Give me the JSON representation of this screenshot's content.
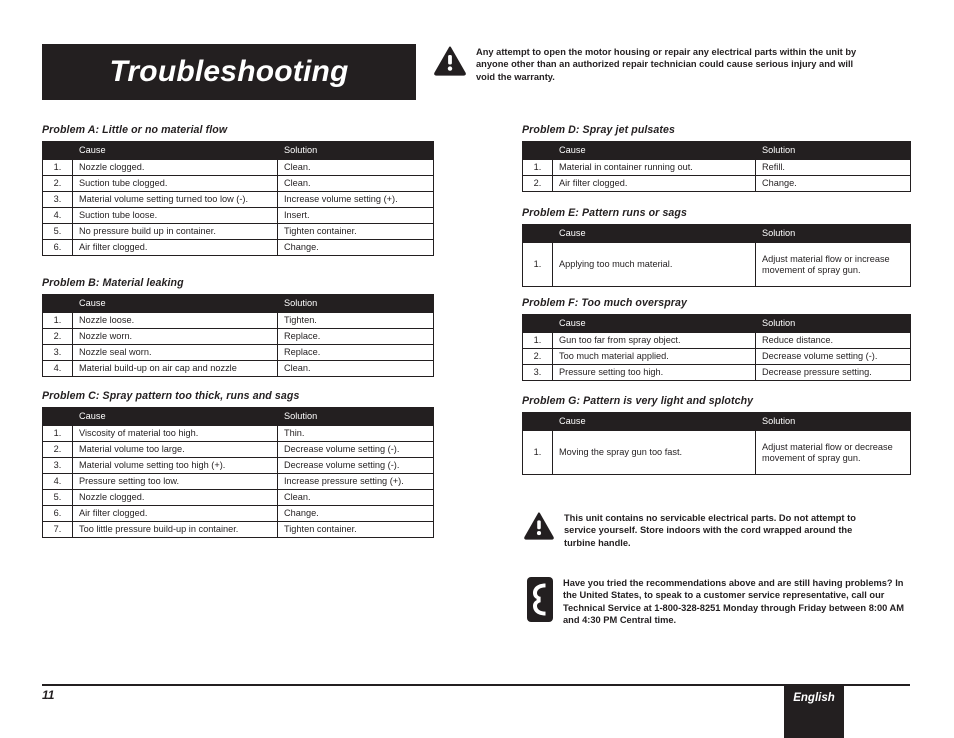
{
  "page": {
    "title": "Troubleshooting",
    "page_number": "11",
    "language_tab": "English"
  },
  "warnings": {
    "top": {
      "icon": "warning-triangle-icon",
      "text": "Any attempt to open the motor housing or repair any electrical parts within the unit by anyone other than an authorized repair technician could cause serious injury and will void the warranty."
    },
    "service": {
      "icon": "warning-triangle-icon",
      "text": "This unit contains no servicable electrical parts.  Do not attempt to service yourself.  Store indoors with the cord wrapped around the turbine handle."
    },
    "phone": {
      "icon": "telephone-icon",
      "text": "Have you tried the recommendations above and are still having problems?  In the United States, to speak to a customer service representative, call our Technical Service at 1-800-328-8251 Monday through Friday between 8:00 AM and 4:30 PM Central time."
    }
  },
  "columns": {
    "cause": "Cause",
    "solution": "Solution"
  },
  "problems": [
    {
      "id": "a",
      "heading": "Problem A: Little or no material flow",
      "rows": [
        {
          "num": "1.",
          "cause": "Nozzle clogged.",
          "solution": "Clean."
        },
        {
          "num": "2.",
          "cause": "Suction tube clogged.",
          "solution": "Clean."
        },
        {
          "num": "3.",
          "cause": "Material volume setting turned too low (-).",
          "solution": "Increase volume setting (+)."
        },
        {
          "num": "4.",
          "cause": "Suction tube loose.",
          "solution": "Insert."
        },
        {
          "num": "5.",
          "cause": "No pressure build up in container.",
          "solution": "Tighten container."
        },
        {
          "num": "6.",
          "cause": "Air filter clogged.",
          "solution": "Change."
        }
      ]
    },
    {
      "id": "b",
      "heading": "Problem B: Material leaking",
      "rows": [
        {
          "num": "1.",
          "cause": "Nozzle loose.",
          "solution": "Tighten."
        },
        {
          "num": "2.",
          "cause": "Nozzle worn.",
          "solution": "Replace."
        },
        {
          "num": "3.",
          "cause": "Nozzle seal worn.",
          "solution": "Replace."
        },
        {
          "num": "4.",
          "cause": "Material build-up on air cap and nozzle",
          "solution": "Clean."
        }
      ]
    },
    {
      "id": "c",
      "heading": "Problem C: Spray pattern too thick, runs and sags",
      "rows": [
        {
          "num": "1.",
          "cause": "Viscosity of material too high.",
          "solution": "Thin."
        },
        {
          "num": "2.",
          "cause": "Material volume too large.",
          "solution": "Decrease volume setting (-)."
        },
        {
          "num": "3.",
          "cause": "Material volume setting too high (+).",
          "solution": "Decrease volume setting (-)."
        },
        {
          "num": "4.",
          "cause": "Pressure setting too low.",
          "solution": "Increase pressure setting (+)."
        },
        {
          "num": "5.",
          "cause": "Nozzle clogged.",
          "solution": "Clean."
        },
        {
          "num": "6.",
          "cause": "Air filter clogged.",
          "solution": "Change."
        },
        {
          "num": "7.",
          "cause": "Too little pressure build-up in container.",
          "solution": "Tighten container."
        }
      ]
    },
    {
      "id": "d",
      "heading": "Problem D: Spray jet pulsates",
      "rows": [
        {
          "num": "1.",
          "cause": "Material in container running out.",
          "solution": "Refill."
        },
        {
          "num": "2.",
          "cause": "Air filter clogged.",
          "solution": "Change."
        }
      ]
    },
    {
      "id": "e",
      "heading": "Problem E: Pattern runs or sags",
      "rows": [
        {
          "num": "1.",
          "cause": "Applying too much material.",
          "solution": "Adjust material flow or increase movement of spray gun."
        }
      ]
    },
    {
      "id": "f",
      "heading": "Problem F: Too much overspray",
      "rows": [
        {
          "num": "1.",
          "cause": "Gun too far from spray object.",
          "solution": "Reduce distance."
        },
        {
          "num": "2.",
          "cause": "Too much material applied.",
          "solution": "Decrease volume setting (-)."
        },
        {
          "num": "3.",
          "cause": "Pressure setting too high.",
          "solution": "Decrease pressure setting."
        }
      ]
    },
    {
      "id": "g",
      "heading": "Problem G: Pattern is very light and splotchy",
      "rows": [
        {
          "num": "1.",
          "cause": "Moving the spray gun too fast.",
          "solution": "Adjust material flow or decrease movement of spray gun."
        }
      ]
    }
  ],
  "colors": {
    "ink": "#231f20",
    "paper": "#ffffff"
  }
}
